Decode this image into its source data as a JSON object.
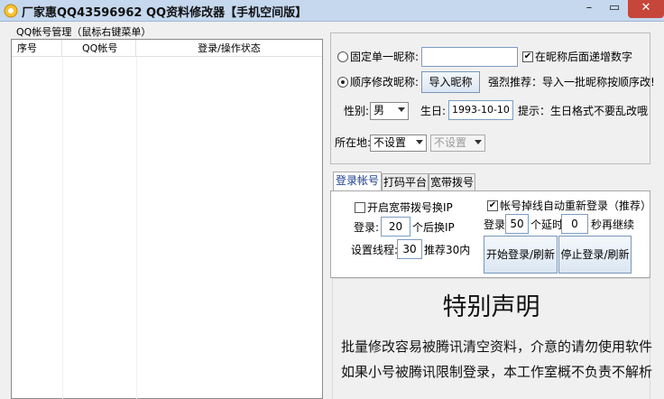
{
  "window": {
    "title": "厂家惠QQ43596962 QQ资料修改器【手机空间版】",
    "close_label": "✕",
    "maximize_label": "▭",
    "minimize_label": "–"
  },
  "account_list": {
    "group_title": "QQ帐号管理（鼠标右键菜单）",
    "columns": [
      "序号",
      "QQ帐号",
      "登录/操作状态"
    ]
  },
  "nickname": {
    "fixed_label": "固定单一昵称:",
    "fixed_value": "",
    "append_number_label": "在昵称后面递增数字",
    "append_number_checked": true,
    "sequential_label": "顺序修改昵称:",
    "sequential_selected": true,
    "import_button": "导入昵称",
    "recommend_text": "强烈推荐：导入一批昵称按顺序改!"
  },
  "profile": {
    "gender_label": "性别:",
    "gender_value": "男",
    "birthday_label": "生日:",
    "birthday_value": "1993-10-10",
    "birthday_hint": "提示：生日格式不要乱改哦",
    "location_label": "所在地:",
    "location_primary": "不设置",
    "location_secondary": "不设置"
  },
  "tabs": [
    "登录帐号",
    "打码平台",
    "宽带拨号"
  ],
  "login": {
    "broadband_ip_label": "开启宽带拨号换IP",
    "broadband_ip_checked": false,
    "login_prefix": "登录:",
    "login_count": "20",
    "login_suffix": "个后换IP",
    "threads_label": "设置线程:",
    "threads_value": "30",
    "threads_hint": "推荐30内",
    "reconnect_label": "帐号掉线自动重新登录（推荐）",
    "reconnect_checked": true,
    "delay_prefix": "登录",
    "delay_count": "50",
    "delay_mid": "个延时",
    "delay_value": "0",
    "delay_suffix": "秒再继续",
    "start_button": "开始登录/刷新",
    "stop_button": "停止登录/刷新"
  },
  "notice": {
    "title": "特别声明",
    "line1": "批量修改容易被腾讯清空资料，介意的请勿使用软件",
    "line2": "如果小号被腾讯限制登录，本工作室概不负责不解析"
  }
}
